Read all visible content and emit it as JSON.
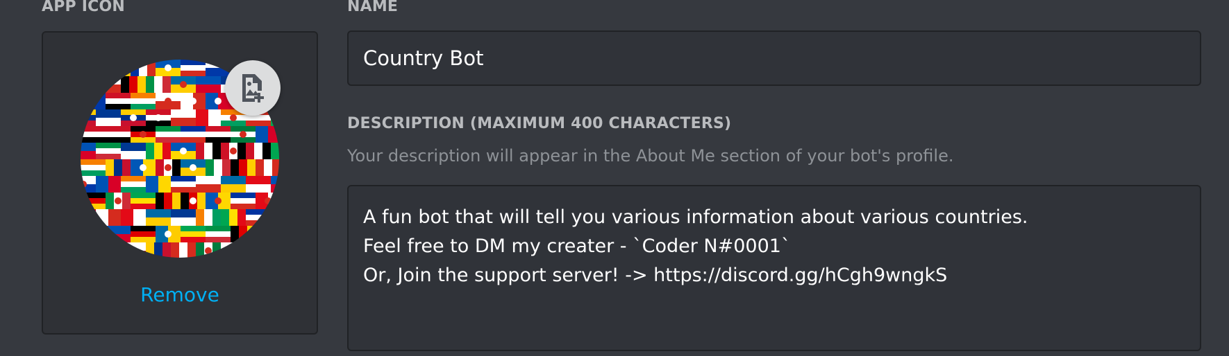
{
  "app_icon": {
    "label": "APP ICON",
    "remove_label": "Remove",
    "upload_icon": "image-add-icon",
    "avatar_image": "flags-collage",
    "colors": {
      "accent": "#00b0f4"
    }
  },
  "name": {
    "label": "NAME",
    "value": "Country Bot"
  },
  "description": {
    "label": "DESCRIPTION (MAXIMUM 400 CHARACTERS)",
    "help_text": "Your description will appear in the About Me section of your bot's profile.",
    "lines": [
      "A fun bot that will tell you various information about various countries.",
      "Feel free to DM my creater - `Coder N#0001`",
      "Or, Join the support server! -> https://discord.gg/hCgh9wngkS"
    ]
  },
  "theme": {
    "background": "#36393f",
    "panel": "#2f3136",
    "input": "#303339",
    "border": "#202225",
    "label_color": "#b9bbbe",
    "muted_text": "#8e9297"
  }
}
